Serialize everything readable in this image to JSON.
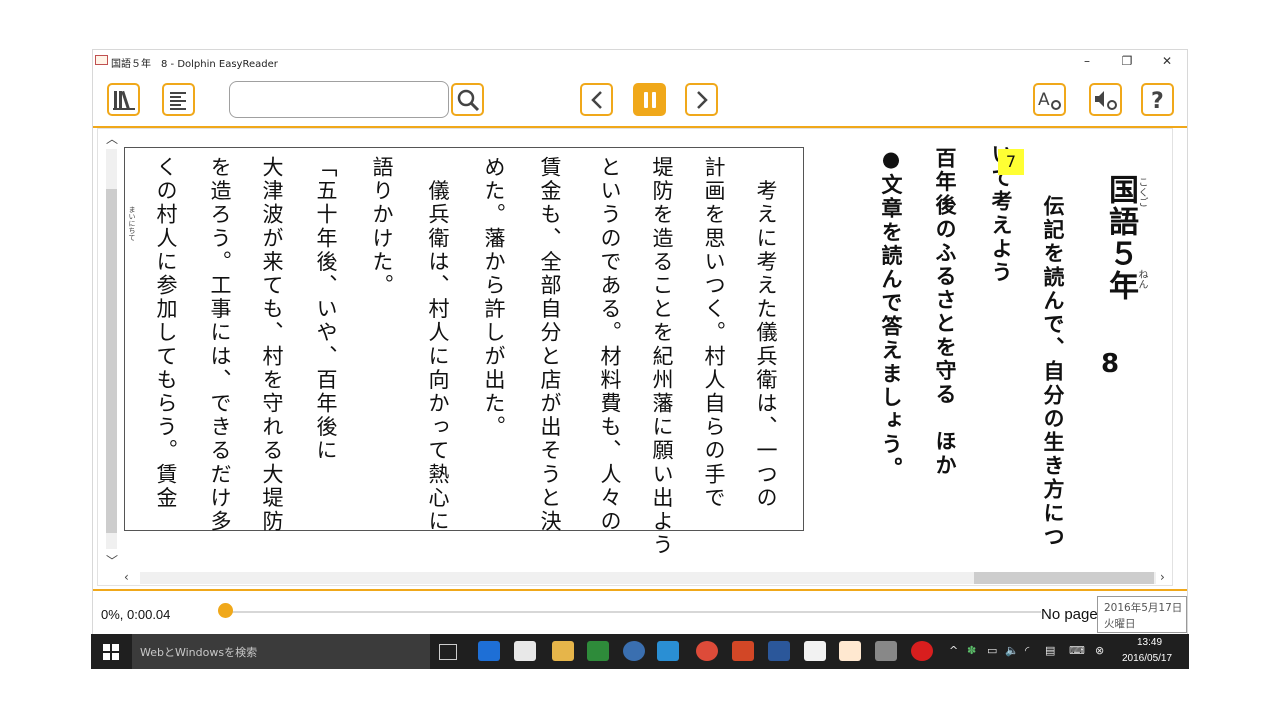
{
  "window": {
    "title": "国語５年　8 - Dolphin EasyReader",
    "minimize": "–",
    "restore": "❐",
    "close": "✕"
  },
  "toolbar": {
    "search_placeholder": "",
    "search_value": ""
  },
  "colors": {
    "accent": "#f0a81a",
    "highlight": "#ffff33"
  },
  "icons": [
    "bookshelf-icon",
    "table-of-contents-icon",
    "search-icon",
    "previous-icon",
    "pause-icon",
    "next-icon",
    "text-settings-icon",
    "audio-settings-icon",
    "help-icon"
  ],
  "book": {
    "header_number": "7",
    "header_title": "国語５年",
    "header_page": "8",
    "header_ruby": {
      "title_reading": "こくご",
      "year_reading": "ねん"
    },
    "intro_columns": [
      "伝記を読んで、自分の生き方につ",
      "いて考えよう",
      "百年後のふるさとを守る　ほか",
      "●文章を読んで答えましょう。"
    ],
    "passage_columns": [
      "　考えに考えた儀兵衛は、一つの",
      "計画を思いつく。村人自らの手で",
      "堤防を造ることを紀州藩に願い出よう",
      "というのである。材料費も、人々の",
      "賃金も、全部自分と店が出そうと決",
      "めた。藩から許しが出た。",
      "　儀兵衛は、村人に向かって熱心に",
      "語りかけた。",
      "「五十年後、いや、百年後に",
      "大津波が来ても、村を守れる大堤防",
      "を造ろう。工事には、できるだけ多",
      "くの村人に参加してもらう。賃金"
    ],
    "margin_ruby": "まいにちて"
  },
  "status": {
    "progress": "0%, 0:00.04",
    "progress_fraction": 0.0,
    "page_label": "No page"
  },
  "taskbar": {
    "search_placeholder": "WebとWindowsを検索",
    "clock_time": "13:49",
    "clock_date": "2016/05/17"
  },
  "tooltip": {
    "date": "2016年5月17日",
    "weekday": "火曜日"
  }
}
